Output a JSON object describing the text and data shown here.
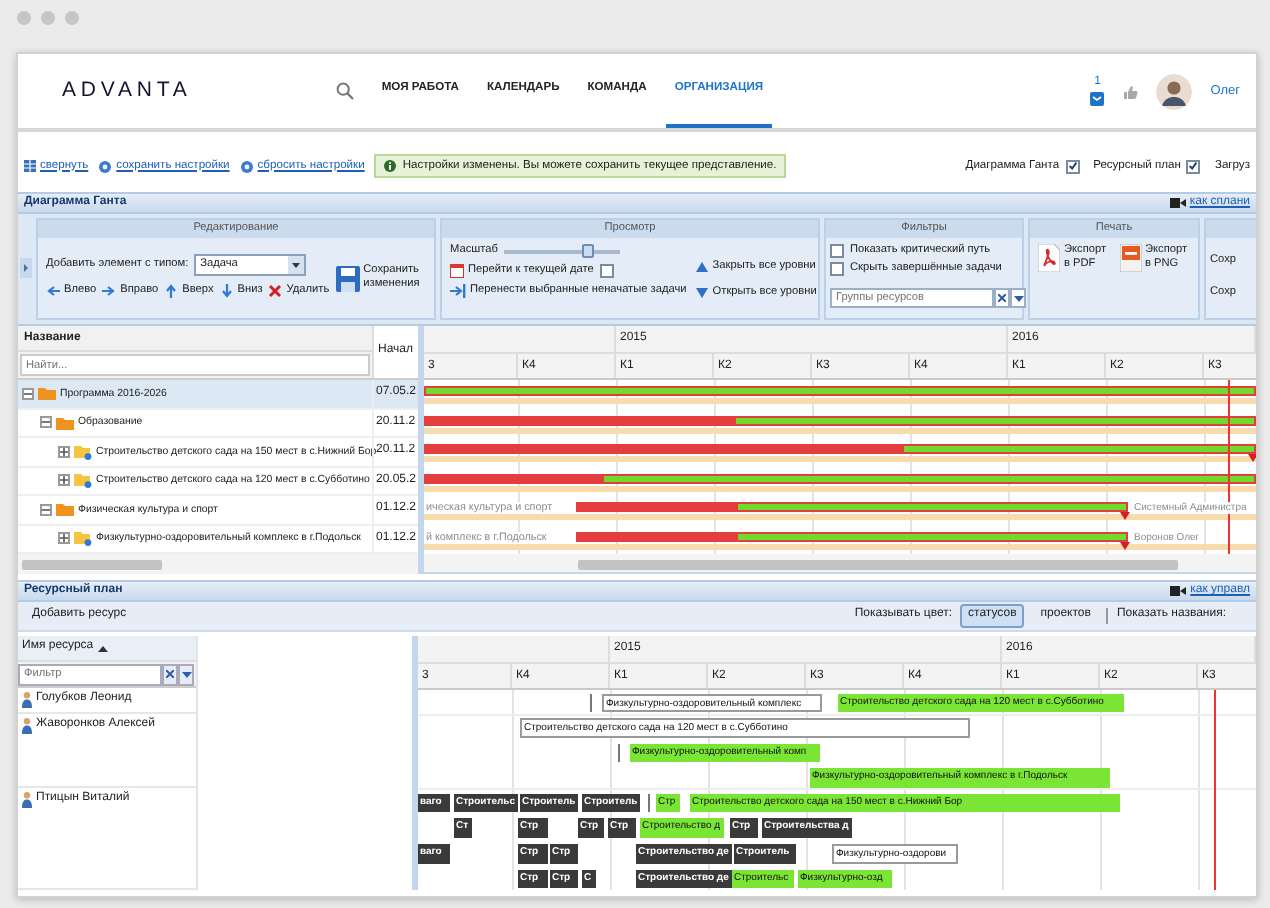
{
  "header": {
    "logo": "ADVANTA",
    "nav": [
      {
        "label": "МОЯ РАБОТА",
        "selected": false
      },
      {
        "label": "КАЛЕНДАРЬ",
        "selected": false
      },
      {
        "label": "КОМАНДА",
        "selected": false
      },
      {
        "label": "ОРГАНИЗАЦИЯ",
        "selected": true
      }
    ],
    "notifications": "1",
    "user": "Олег"
  },
  "settings_bar": {
    "actions": [
      "свернуть",
      "сохранить настройки",
      "сбросить настройки"
    ],
    "notice": "Настройки изменены. Вы можете сохранить текущее представление.",
    "panels": [
      {
        "label": "Диаграмма Ганта",
        "checked": true
      },
      {
        "label": "Ресурсный план",
        "checked": true
      }
    ],
    "cut_panel": "Загруз"
  },
  "gantt": {
    "title": "Диаграмма Ганта",
    "help_link": "как сплани",
    "ribbon": {
      "editing": {
        "title": "Редактирование",
        "type_label": "Добавить элемент с типом:",
        "type_value": "Задача",
        "save": "Сохранить изменения",
        "moves": [
          "Влево",
          "Вправо",
          "Вверх",
          "Вниз"
        ],
        "delete": "Удалить"
      },
      "view": {
        "title": "Просмотр",
        "zoom": {
          "label": "Масштаб",
          "level": 0.75
        },
        "goto_today": {
          "label": "Перейти к текущей дате",
          "checked": false
        },
        "move_tasks": "Перенести выбранные неначатые задачи",
        "collapse_all": "Закрыть все уровни",
        "expand_all": "Открыть все уровни"
      },
      "filters": {
        "title": "Фильтры",
        "options": [
          {
            "label": "Показать критический путь",
            "checked": false
          },
          {
            "label": "Скрыть завершённые задачи",
            "checked": false
          }
        ],
        "resource_groups": {
          "placeholder": "Группы ресурсов"
        }
      },
      "print": {
        "title": "Печать",
        "exports": [
          {
            "label": "Экспорт в PDF",
            "kind": "pdf"
          },
          {
            "label": "Экспорт в PNG",
            "kind": "png"
          }
        ]
      },
      "more": [
        "Сохр",
        "Сохр"
      ]
    },
    "columns": [
      "Название",
      "Начал"
    ],
    "search": {
      "placeholder": "Найти..."
    },
    "years": [
      "2015",
      "2016"
    ],
    "quarters": [
      "3",
      "К4",
      "К1",
      "К2",
      "К3",
      "К4",
      "К1",
      "К2",
      "К3"
    ],
    "rows": [
      {
        "name": "Программа 2016-2026",
        "start": "07.05.2",
        "kind": "group",
        "expanded": true,
        "selected": true,
        "children": [
          {
            "name": "Образование",
            "start": "20.11.2",
            "kind": "group",
            "expanded": true,
            "selected": false,
            "children": [
              {
                "name": "Строительство детского сада на 150 мест в с.Нижний Бор",
                "start": "20.11.2",
                "kind": "project",
                "expanded": false,
                "selected": false
              },
              {
                "name": "Строительство детского сада на 120 мест в с.Субботино",
                "start": "20.05.2",
                "kind": "project",
                "expanded": false,
                "selected": false
              }
            ]
          },
          {
            "name": "Физическая культура и спорт",
            "start": "01.12.2",
            "kind": "group",
            "expanded": true,
            "selected": false,
            "bar_left_label": "ическая культура и спорт",
            "bar_caption": "Системный Администра",
            "children": [
              {
                "name": "Физкультурно-оздоровительный комплекс в г.Подольск",
                "start": "01.12.2",
                "kind": "project",
                "expanded": false,
                "selected": false,
                "bar_left_label": "й комплекс в г.Подольск",
                "bar_caption": "Воронов Олег"
              }
            ]
          }
        ]
      }
    ]
  },
  "resources": {
    "title": "Ресурсный план",
    "help_link": "как управл",
    "add": "Добавить ресурс",
    "color_label": "Показывать цвет:",
    "color_modes": [
      {
        "label": "статусов",
        "selected": true
      },
      {
        "label": "проектов",
        "selected": false
      }
    ],
    "names_label": "Показать названия:",
    "column": "Имя ресурса",
    "filter": {
      "placeholder": "Фильтр"
    },
    "years": [
      "2015",
      "2016"
    ],
    "quarters": [
      "3",
      "К4",
      "К1",
      "К2",
      "К3",
      "К4",
      "К1",
      "К2",
      "К3"
    ],
    "rows": [
      {
        "name": "Голубков Леонид",
        "lines": [
          [
            {
              "label": "Физкультурно-оздоровительный комплекс",
              "color": "#ffffff"
            },
            {
              "label": "Строительство детского сада на 120 мест в с.Субботино",
              "color": "#7ae535"
            }
          ]
        ]
      },
      {
        "name": "Жаворонков Алексей",
        "lines": [
          [
            {
              "label": "Строительство детского сада на 120 мест в с.Субботино",
              "color": "#ffffff"
            }
          ],
          [
            {
              "label": "Физкультурно-оздоровительный комп",
              "color": "#7ae535"
            }
          ],
          [
            {
              "label": "Физкультурно-оздоровительный комплекс в г.Подольск",
              "color": "#7ae535"
            }
          ]
        ]
      },
      {
        "name": "Птицын Виталий",
        "lines": [
          [
            {
              "label": "ваго",
              "color": "#3a3a3a"
            },
            {
              "label": "Строительс",
              "color": "#3a3a3a"
            },
            {
              "label": "Строитель",
              "color": "#3a3a3a"
            },
            {
              "label": "Строитель",
              "color": "#3a3a3a"
            },
            {
              "label": "Стр",
              "color": "#7ae535"
            },
            {
              "label": "Строительство детского сада на 150 мест в с.Нижний Бор",
              "color": "#7ae535"
            }
          ],
          [
            {
              "label": "Ст",
              "color": "#3a3a3a"
            },
            {
              "label": "Стр",
              "color": "#3a3a3a"
            },
            {
              "label": "Стр",
              "color": "#3a3a3a"
            },
            {
              "label": "Стр",
              "color": "#3a3a3a"
            },
            {
              "label": "Строительство д",
              "color": "#7ae535"
            },
            {
              "label": "Стр",
              "color": "#3a3a3a"
            },
            {
              "label": "Строительства д",
              "color": "#3a3a3a"
            }
          ],
          [
            {
              "label": "ваго",
              "color": "#3a3a3a"
            },
            {
              "label": "Стр",
              "color": "#3a3a3a"
            },
            {
              "label": "Стр",
              "color": "#3a3a3a"
            },
            {
              "label": "Строительство де",
              "color": "#3a3a3a"
            },
            {
              "label": "Строитель",
              "color": "#3a3a3a"
            },
            {
              "label": "Физкультурно-оздорови",
              "color": "#ffffff"
            }
          ],
          [
            {
              "label": "Стр",
              "color": "#3a3a3a"
            },
            {
              "label": "Стр",
              "color": "#3a3a3a"
            },
            {
              "label": "С",
              "color": "#3a3a3a"
            },
            {
              "label": "Строительство де",
              "color": "#3a3a3a"
            },
            {
              "label": "Строительс",
              "color": "#7ae535"
            },
            {
              "label": "Физкультурно-озд",
              "color": "#7ae535"
            }
          ]
        ]
      }
    ]
  }
}
